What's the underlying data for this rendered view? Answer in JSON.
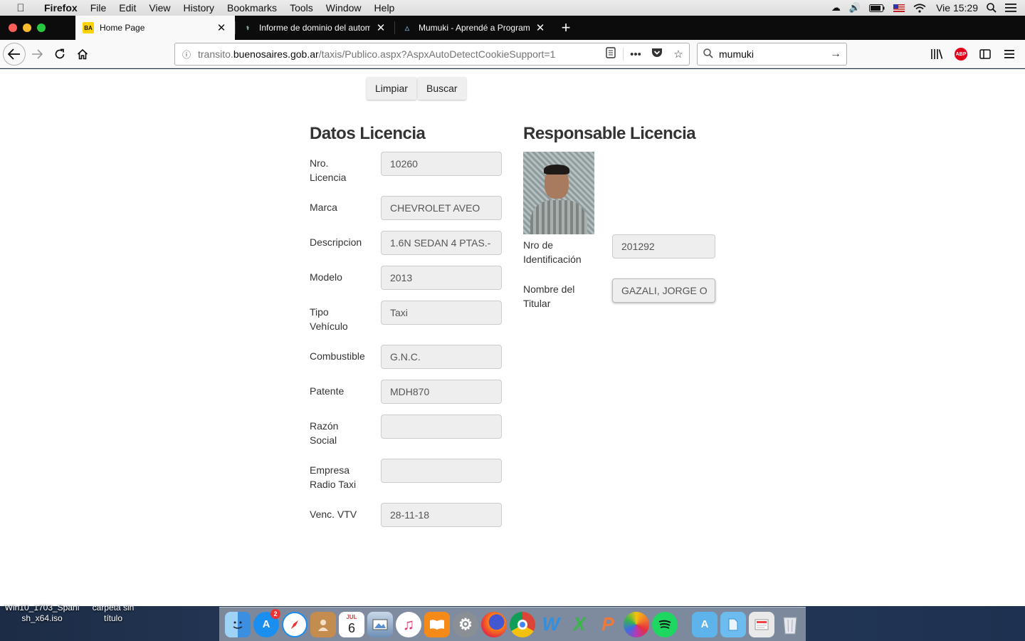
{
  "menubar": {
    "app_name": "Firefox",
    "menus": [
      "File",
      "Edit",
      "View",
      "History",
      "Bookmarks",
      "Tools",
      "Window",
      "Help"
    ],
    "clock": "Vie 15:29"
  },
  "tabs": [
    {
      "title": "Home Page",
      "favicon_text": "BA",
      "active": true
    },
    {
      "title": "Informe de dominio del automotor",
      "active": false
    },
    {
      "title": "Mumuki - Aprendé a Programar",
      "active": false
    }
  ],
  "navbar": {
    "url_prefix": "transito.",
    "url_domain": "buenosaires.gob.ar",
    "url_path": "/taxis/Publico.aspx?AspxAutoDetectCookieSupport=1",
    "search_value": "mumuki",
    "abp_label": "ABP"
  },
  "buttons": {
    "limpiar": "Limpiar",
    "buscar": "Buscar"
  },
  "datos_licencia": {
    "heading": "Datos Licencia",
    "fields": [
      {
        "label": "Nro. Licencia",
        "value": "10260"
      },
      {
        "label": "Marca",
        "value": "CHEVROLET AVEO"
      },
      {
        "label": "Descripcion",
        "value": "1.6N SEDAN 4 PTAS.-"
      },
      {
        "label": "Modelo",
        "value": "2013"
      },
      {
        "label": "Tipo Vehículo",
        "value": "Taxi"
      },
      {
        "label": "Combustible",
        "value": "G.N.C."
      },
      {
        "label": "Patente",
        "value": "MDH870"
      },
      {
        "label": "Razón Social",
        "value": ""
      },
      {
        "label": "Empresa Radio Taxi",
        "value": ""
      },
      {
        "label": "Venc. VTV",
        "value": "28-11-18"
      }
    ]
  },
  "responsable_licencia": {
    "heading": "Responsable Licencia",
    "fields": [
      {
        "label": "Nro de Identificación",
        "value": "201292"
      },
      {
        "label": "Nombre del Titular",
        "value": "GAZALI, JORGE O"
      }
    ]
  },
  "desktop": {
    "item1": "Win10_1703_Spanish_x64.iso",
    "item2": "carpeta sin título"
  },
  "dock": {
    "appstore_badge": "2",
    "calendar_month": "JUL",
    "calendar_day": "6"
  }
}
